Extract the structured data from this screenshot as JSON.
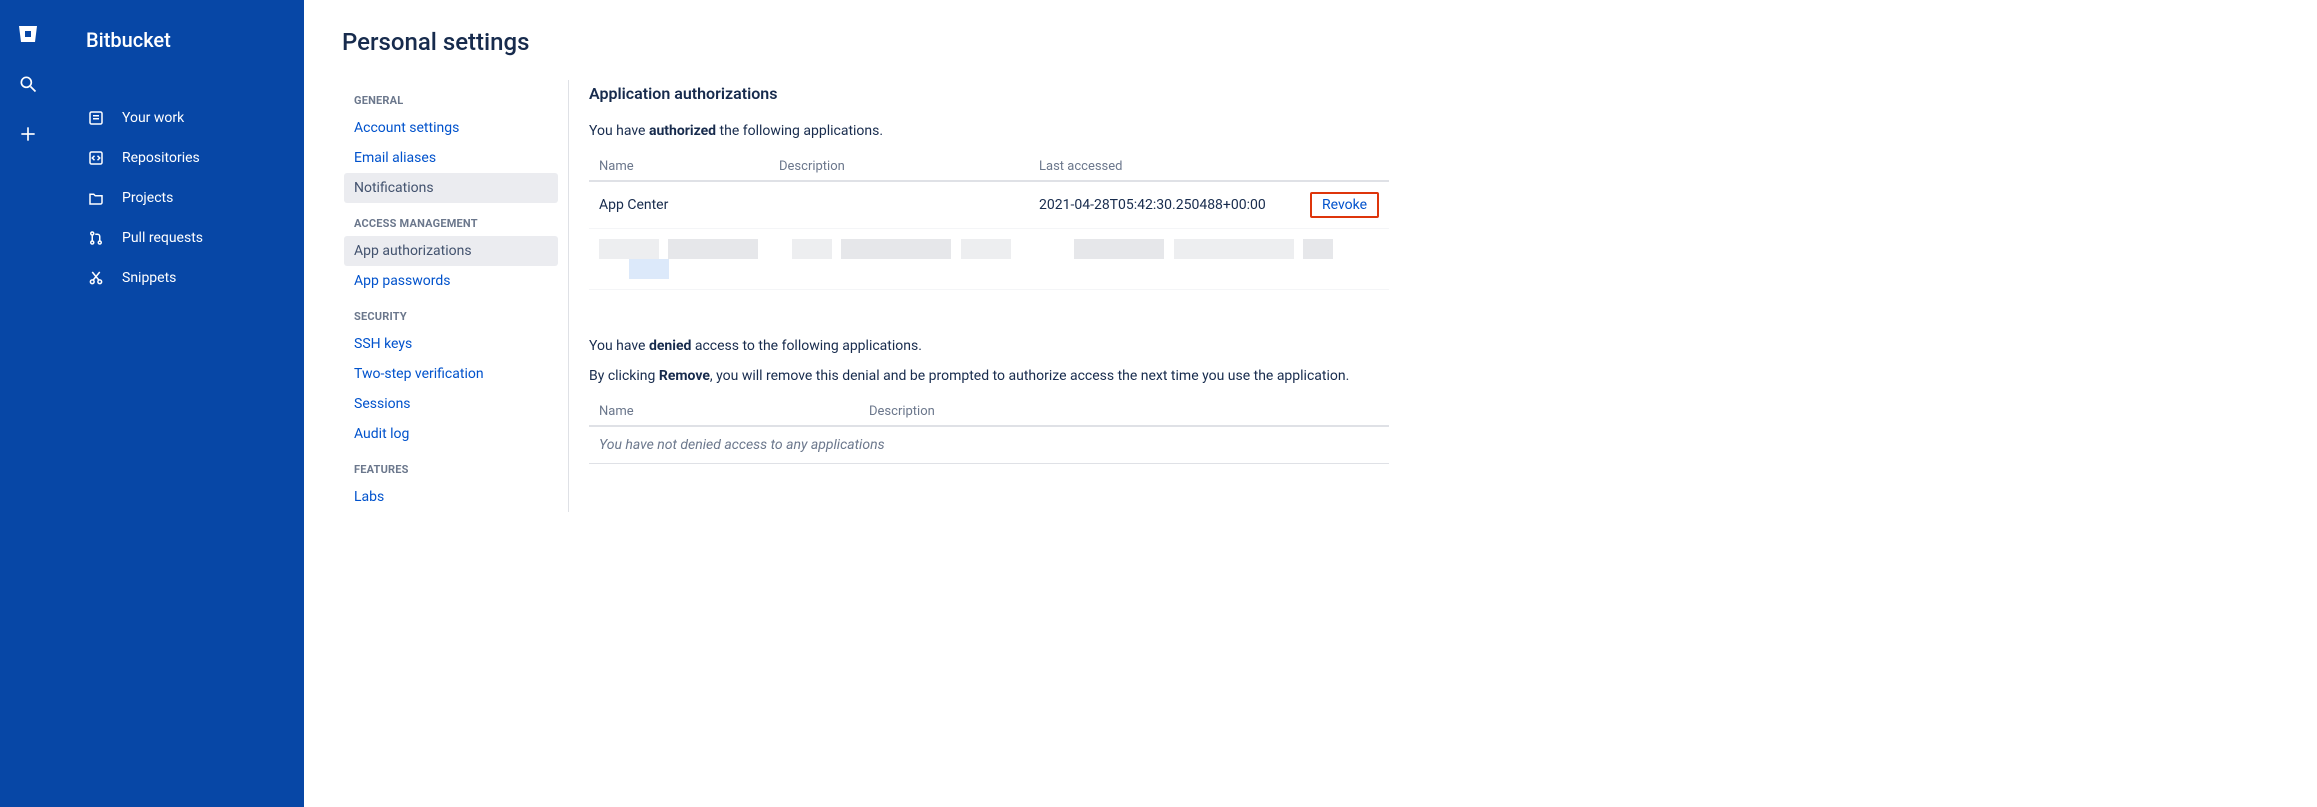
{
  "brand": "Bitbucket",
  "nav": {
    "items": [
      {
        "label": "Your work"
      },
      {
        "label": "Repositories"
      },
      {
        "label": "Projects"
      },
      {
        "label": "Pull requests"
      },
      {
        "label": "Snippets"
      }
    ]
  },
  "page_title": "Personal settings",
  "settings_groups": [
    {
      "heading": "GENERAL",
      "items": [
        {
          "label": "Account settings",
          "active": false
        },
        {
          "label": "Email aliases",
          "active": false
        },
        {
          "label": "Notifications",
          "active": true
        }
      ]
    },
    {
      "heading": "ACCESS MANAGEMENT",
      "items": [
        {
          "label": "App authorizations",
          "active": true
        },
        {
          "label": "App passwords",
          "active": false
        }
      ]
    },
    {
      "heading": "SECURITY",
      "items": [
        {
          "label": "SSH keys",
          "active": false
        },
        {
          "label": "Two-step verification",
          "active": false
        },
        {
          "label": "Sessions",
          "active": false
        },
        {
          "label": "Audit log",
          "active": false
        }
      ]
    },
    {
      "heading": "FEATURES",
      "items": [
        {
          "label": "Labs",
          "active": false
        }
      ]
    }
  ],
  "content": {
    "section_title": "Application authorizations",
    "authorized_intro_prefix": "You have ",
    "authorized_intro_bold": "authorized",
    "authorized_intro_suffix": " the following applications.",
    "auth_columns": {
      "name": "Name",
      "description": "Description",
      "last_accessed": "Last accessed"
    },
    "auth_rows": [
      {
        "name": "App Center",
        "description": "",
        "last_accessed": "2021-04-28T05:42:30.250488+00:00",
        "action": "Revoke"
      }
    ],
    "denied_intro_prefix": "You have ",
    "denied_intro_bold": "denied",
    "denied_intro_suffix": " access to the following applications.",
    "denied_help_prefix": "By clicking ",
    "denied_help_bold": "Remove",
    "denied_help_suffix": ", you will remove this denial and be prompted to authorize access the next time you use the application.",
    "denied_columns": {
      "name": "Name",
      "description": "Description"
    },
    "denied_empty": "You have not denied access to any applications"
  }
}
